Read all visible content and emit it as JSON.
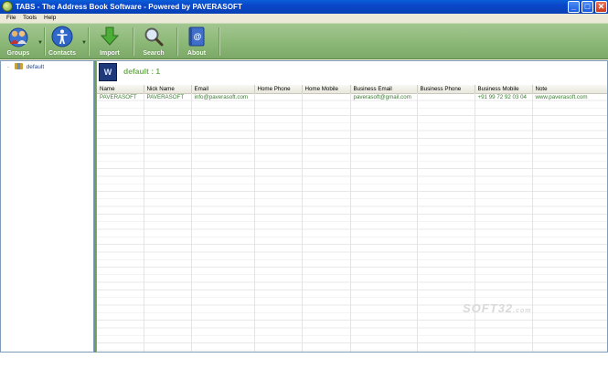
{
  "window": {
    "title": "TABS - The Address Book Software - Powered by PAVERASOFT",
    "minimize": "_",
    "maximize": "□",
    "close": "✕"
  },
  "menu": [
    "File",
    "Tools",
    "Help"
  ],
  "toolbar": {
    "groups": "Groups",
    "contacts": "Contacts",
    "import": "Import",
    "search": "Search",
    "about": "About"
  },
  "tree": {
    "items": [
      {
        "label": "default",
        "expander": "-"
      }
    ]
  },
  "group_header": {
    "icon_text": "W",
    "title": "default : 1"
  },
  "table": {
    "columns": [
      "Name",
      "Nick Name",
      "Email",
      "Home Phone",
      "Home Mobile",
      "Business Email",
      "Business Phone",
      "Business Mobile",
      "Note"
    ],
    "rows": [
      [
        "PAVERASOFT",
        "PAVERASOFT",
        "info@paverasoft.com",
        "",
        "",
        "paverasoft@gmail.com",
        "",
        "+91 99 72 92 03 04",
        "www.paverasoft.com"
      ]
    ]
  },
  "watermark": {
    "text": "SOFT32",
    "suffix": ".com"
  },
  "colors": {
    "toolbar_green": "#8cb877",
    "titlebar_blue": "#0a46c8",
    "cell_text": "#3d7d35",
    "group_title": "#6fae52"
  }
}
